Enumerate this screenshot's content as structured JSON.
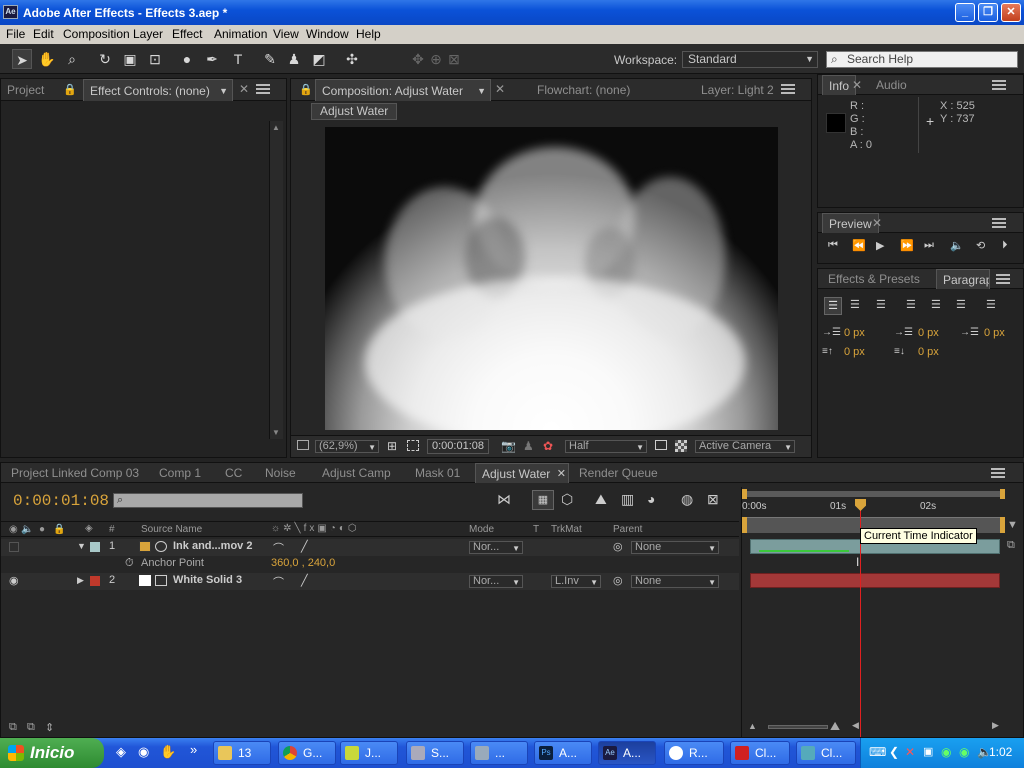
{
  "window": {
    "title": "Adobe After Effects - Effects 3.aep *",
    "app_icon": "Ae"
  },
  "menu": [
    "File",
    "Edit",
    "Composition",
    "Layer",
    "Effect",
    "Animation",
    "View",
    "Window",
    "Help"
  ],
  "toolbar": {
    "workspace_label": "Workspace:",
    "workspace_value": "Standard",
    "search_placeholder": "Search Help"
  },
  "left_panel": {
    "tab_project": "Project",
    "tab_effect_controls": "Effect Controls: (none)"
  },
  "comp_panel": {
    "tab_composition": "Composition: Adjust Water",
    "tab_flowchart": "Flowchart: (none)",
    "tab_layer": "Layer: Light 2",
    "breadcrumb": "Adjust Water",
    "zoom": "(62,9%)",
    "timecode": "0:00:01:08",
    "resolution": "Half",
    "camera": "Active Camera"
  },
  "info_panel": {
    "tab_info": "Info",
    "tab_audio": "Audio",
    "r": "R :",
    "g": "G :",
    "b": "B :",
    "a": "A : 0",
    "x": "X : 525",
    "y": "Y : 737"
  },
  "preview_panel": {
    "tab": "Preview"
  },
  "effects_panel": {
    "tab_effects": "Effects & Presets",
    "tab_paragraph": "Paragrap",
    "indent_left": "0 px",
    "indent_first": "0 px",
    "indent_right": "0 px",
    "space_before": "0 px",
    "space_after": "0 px"
  },
  "timeline": {
    "tabs": [
      "Project Linked Comp 03",
      "Comp 1",
      "CC",
      "Noise",
      "Adjust Camp",
      "Mask 01",
      "Adjust Water",
      "Render Queue"
    ],
    "active_tab": "Adjust Water",
    "current_time": "0:00:01:08",
    "columns": {
      "num": "#",
      "source": "Source Name",
      "mode": "Mode",
      "t": "T",
      "trkmat": "TrkMat",
      "parent": "Parent"
    },
    "layers": [
      {
        "num": "1",
        "name": "Ink and...mov 2",
        "mode": "Nor...",
        "trkmat": "",
        "parent": "None",
        "label_color": "#a8c8c8"
      },
      {
        "num": "2",
        "name": "White Solid 3",
        "mode": "Nor...",
        "trkmat": "L.Inv",
        "parent": "None",
        "label_color": "#c0392b"
      }
    ],
    "property": {
      "name": "Anchor Point",
      "value": "360,0 , 240,0"
    },
    "ruler": [
      "0:00s",
      "01s",
      "02s"
    ],
    "tooltip": "Current Time Indicator"
  },
  "taskbar": {
    "start": "Inicio",
    "buttons": [
      "13",
      "G...",
      "J...",
      "S...",
      "...",
      "A...",
      "A...",
      "R...",
      "Cl...",
      "Cl..."
    ],
    "clock": "1:02"
  }
}
